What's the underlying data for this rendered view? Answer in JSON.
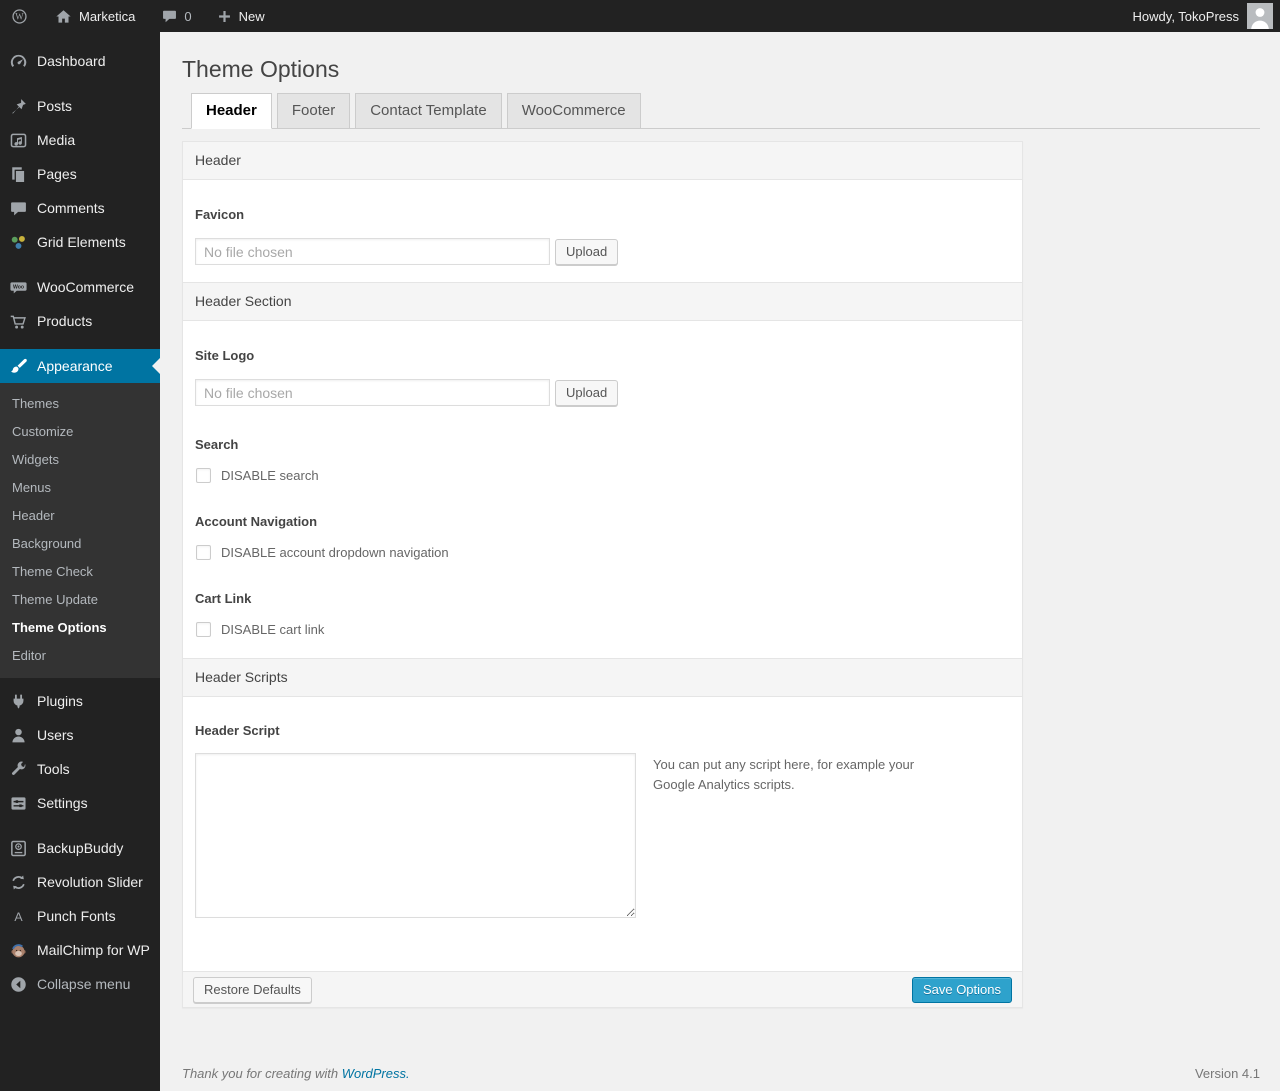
{
  "admin_bar": {
    "site_name": "Marketica",
    "comment_count": "0",
    "new_label": "New",
    "howdy_label": "Howdy, TokoPress"
  },
  "sidebar": {
    "items": [
      {
        "label": "Dashboard",
        "icon": "dashboard-icon"
      },
      {
        "label": "Posts",
        "icon": "pin-icon"
      },
      {
        "label": "Media",
        "icon": "media-icon"
      },
      {
        "label": "Pages",
        "icon": "pages-icon"
      },
      {
        "label": "Comments",
        "icon": "comments-icon"
      },
      {
        "label": "Grid Elements",
        "icon": "grid-elements-icon"
      },
      {
        "label": "WooCommerce",
        "icon": "woocommerce-icon"
      },
      {
        "label": "Products",
        "icon": "cart-icon"
      },
      {
        "label": "Appearance",
        "icon": "paintbrush-icon",
        "active": true
      },
      {
        "label": "Plugins",
        "icon": "plugin-icon"
      },
      {
        "label": "Users",
        "icon": "user-icon"
      },
      {
        "label": "Tools",
        "icon": "wrench-icon"
      },
      {
        "label": "Settings",
        "icon": "settings-icon"
      },
      {
        "label": "BackupBuddy",
        "icon": "backup-drive-icon"
      },
      {
        "label": "Revolution Slider",
        "icon": "refresh-icon"
      },
      {
        "label": "Punch Fonts",
        "icon": "letter-a-icon"
      },
      {
        "label": "MailChimp for WP",
        "icon": "mailchimp-monkey-icon"
      },
      {
        "label": "Collapse menu",
        "icon": "collapse-arrow-icon"
      }
    ],
    "appearance_submenu": [
      {
        "label": "Themes"
      },
      {
        "label": "Customize"
      },
      {
        "label": "Widgets"
      },
      {
        "label": "Menus"
      },
      {
        "label": "Header"
      },
      {
        "label": "Background"
      },
      {
        "label": "Theme Check"
      },
      {
        "label": "Theme Update"
      },
      {
        "label": "Theme Options",
        "current": true
      },
      {
        "label": "Editor"
      }
    ]
  },
  "main": {
    "title": "Theme Options",
    "tabs": [
      {
        "label": "Header",
        "active": true
      },
      {
        "label": "Footer"
      },
      {
        "label": "Contact Template"
      },
      {
        "label": "WooCommerce"
      }
    ],
    "panel": {
      "section_header": {
        "heading": "Header",
        "favicon_label": "Favicon",
        "favicon_value": "No file chosen",
        "upload_label": "Upload"
      },
      "section_header_section": {
        "heading": "Header Section",
        "site_logo_label": "Site Logo",
        "site_logo_value": "No file chosen",
        "upload_label": "Upload",
        "search_label": "Search",
        "search_checkbox_label": "DISABLE search",
        "account_label": "Account Navigation",
        "account_checkbox_label": "DISABLE account dropdown navigation",
        "cart_label": "Cart Link",
        "cart_checkbox_label": "DISABLE cart link"
      },
      "section_header_scripts": {
        "heading": "Header Scripts",
        "script_label": "Header Script",
        "script_hint": "You can put any script here, for example your Google Analytics scripts."
      },
      "actions": {
        "restore_label": "Restore Defaults",
        "save_label": "Save Options"
      }
    }
  },
  "page_footer": {
    "thanks_text": "Thank you for creating with ",
    "wordpress_link": "WordPress.",
    "version": "Version 4.1"
  },
  "colors": {
    "admin_menu_bg": "#222222",
    "admin_submenu_bg": "#333333",
    "menu_highlight": "#0074a2",
    "primary_button": "#2ea2cc",
    "link": "#0074a2",
    "page_bg": "#f1f1f1"
  }
}
